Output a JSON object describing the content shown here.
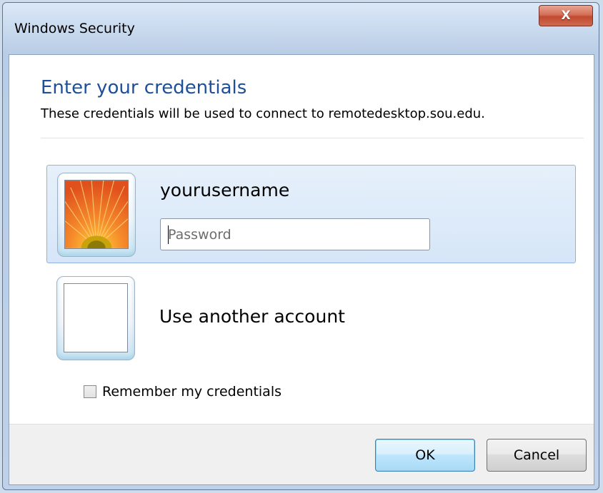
{
  "window": {
    "title": "Windows Security",
    "close_glyph": "X"
  },
  "header": {
    "title": "Enter your credentials",
    "subtitle": "These credentials will be used to connect to remotedesktop.sou.edu."
  },
  "accounts": [
    {
      "username": "yourusername",
      "avatar_icon": "flower-avatar-icon",
      "selected": true,
      "password_value": "",
      "password_placeholder": "Password"
    },
    {
      "label": "Use another account",
      "avatar_icon": "blank-avatar-icon",
      "selected": false
    }
  ],
  "remember": {
    "label": "Remember my credentials",
    "checked": false
  },
  "buttons": {
    "ok": "OK",
    "cancel": "Cancel"
  },
  "colors": {
    "accent_title": "#1e4f9a",
    "selected_tile": "#d6e6f8",
    "close_button": "#c14a30"
  }
}
